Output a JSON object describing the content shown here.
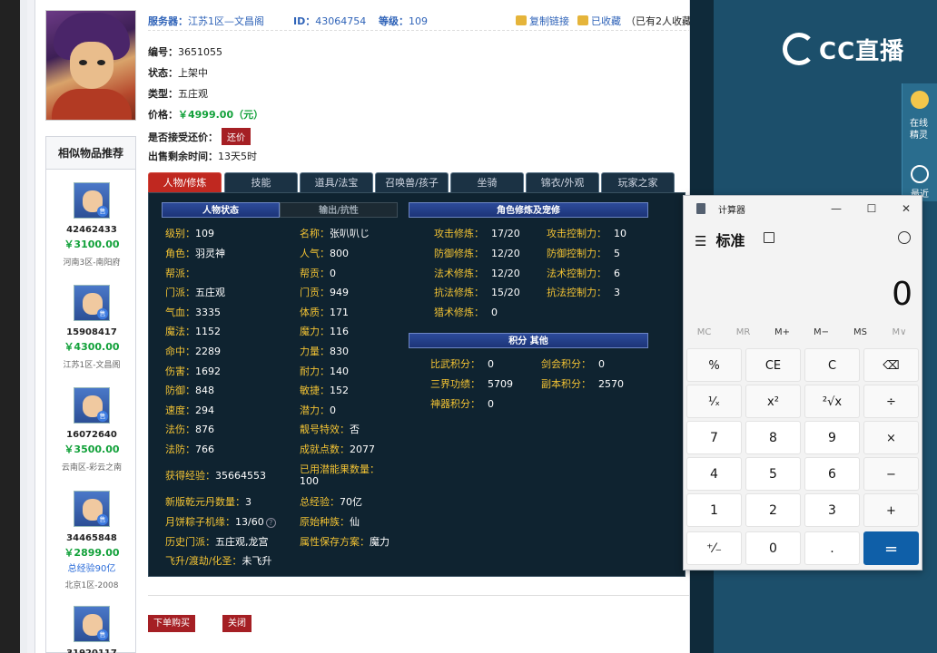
{
  "top": {
    "server_label": "服务器：",
    "server_value": "江苏1区—文昌阁",
    "id_label": "ID：",
    "id_value": "43064754",
    "level_label": "等级：",
    "level_value": "109",
    "copy_link": "复制链接",
    "favorited": "已收藏",
    "fav_count": "（已有2人收藏）"
  },
  "info": {
    "number_label": "编号：",
    "number_value": "3651055",
    "status_label": "状态：",
    "status_value": "上架中",
    "type_label": "类型：",
    "type_value": "五庄观",
    "price_label": "价格：",
    "price_value": "￥4999.00（元）",
    "bargain_label": "是否接受还价：",
    "bargain_btn": "还价",
    "remain_label": "出售剩余时间：",
    "remain_value": "13天5时"
  },
  "similar": {
    "title": "相似物品推荐",
    "items": [
      {
        "id": "42462433",
        "price": "￥3100.00",
        "extra": "",
        "server": "河南3区-南阳府"
      },
      {
        "id": "15908417",
        "price": "￥4300.00",
        "extra": "",
        "server": "江苏1区-文昌阁"
      },
      {
        "id": "16072640",
        "price": "￥3500.00",
        "extra": "",
        "server": "云南区-彩云之南"
      },
      {
        "id": "34465848",
        "price": "￥2899.00",
        "extra": "总经验90亿",
        "server": "北京1区-2008"
      },
      {
        "id": "31920117",
        "price": "",
        "extra": "",
        "server": ""
      }
    ]
  },
  "tabs": [
    "人物/修炼",
    "技能",
    "道具/法宝",
    "召唤兽/孩子",
    "坐骑",
    "锦衣/外观",
    "玩家之家"
  ],
  "panel": {
    "head_status": "人物状态",
    "head_output": "输出/抗性",
    "head_cultivation": "角色修炼及宠修",
    "head_points": "积分 其他",
    "left": [
      {
        "k": "级别：",
        "v": "109"
      },
      {
        "k": "角色：",
        "v": "羽灵神"
      },
      {
        "k": "帮派：",
        "v": ""
      },
      {
        "k": "门派：",
        "v": "五庄观"
      },
      {
        "k": "气血：",
        "v": "3335"
      },
      {
        "k": "魔法：",
        "v": "1152"
      },
      {
        "k": "命中：",
        "v": "2289"
      },
      {
        "k": "伤害：",
        "v": "1692"
      },
      {
        "k": "防御：",
        "v": "848"
      },
      {
        "k": "速度：",
        "v": "294"
      },
      {
        "k": "法伤：",
        "v": "876"
      },
      {
        "k": "法防：",
        "v": "766"
      }
    ],
    "mid": [
      {
        "k": "名称：",
        "v": "张叭叭じ"
      },
      {
        "k": "人气：",
        "v": "800"
      },
      {
        "k": "帮贡：",
        "v": "0"
      },
      {
        "k": "门贡：",
        "v": "949"
      },
      {
        "k": "体质：",
        "v": "171"
      },
      {
        "k": "魔力：",
        "v": "116"
      },
      {
        "k": "力量：",
        "v": "830"
      },
      {
        "k": "耐力：",
        "v": "140"
      },
      {
        "k": "敏捷：",
        "v": "152"
      },
      {
        "k": "潜力：",
        "v": "0"
      },
      {
        "k": "靓号特效：",
        "v": "否"
      },
      {
        "k": "成就点数：",
        "v": "2077"
      }
    ],
    "exp_label": "获得经验：",
    "exp_value": "35664553",
    "potential_label": "已用潜能果数量：",
    "potential_value": "100",
    "qiankun_label": "新版乾元丹数量：",
    "qiankun_value": "3",
    "total_exp_label": "总经验：",
    "total_exp_value": "70亿",
    "moon_label": "月饼粽子机缘：",
    "moon_value": "13/60",
    "race_label": "原始种族：",
    "race_value": "仙",
    "history_label": "历史门派：",
    "history_value": "五庄观,龙宫",
    "attr_label": "属性保存方案：",
    "attr_value": "魔力",
    "fly_label": "飞升/渡劫/化圣：",
    "fly_value": "未飞升",
    "cult": [
      {
        "k": "攻击修炼：",
        "v": "17/20",
        "k2": "攻击控制力：",
        "v2": "10"
      },
      {
        "k": "防御修炼：",
        "v": "12/20",
        "k2": "防御控制力：",
        "v2": "5"
      },
      {
        "k": "法术修炼：",
        "v": "12/20",
        "k2": "法术控制力：",
        "v2": "6"
      },
      {
        "k": "抗法修炼：",
        "v": "15/20",
        "k2": "抗法控制力：",
        "v2": "3"
      },
      {
        "k": "猎术修炼：",
        "v": "0",
        "k2": "",
        "v2": ""
      }
    ],
    "points": [
      {
        "k": "比武积分：",
        "v": "0",
        "k2": "剑会积分：",
        "v2": "0"
      },
      {
        "k": "三界功绩：",
        "v": "5709",
        "k2": "副本积分：",
        "v2": "2570"
      },
      {
        "k": "神器积分：",
        "v": "0",
        "k2": "",
        "v2": ""
      }
    ]
  },
  "buttons": {
    "buy": "下单购买",
    "close": "关闭"
  },
  "cc": {
    "logo": "CC直播",
    "tool1": "在线精灵",
    "tool2": "最近"
  },
  "calc": {
    "title": "计算器",
    "mode": "标准",
    "display": "0",
    "mem": [
      "MC",
      "MR",
      "M+",
      "M−",
      "MS",
      "M∨"
    ],
    "keys": [
      [
        "%",
        "CE",
        "C",
        "⌫"
      ],
      [
        "¹⁄ₓ",
        "x²",
        "²√x",
        "÷"
      ],
      [
        "7",
        "8",
        "9",
        "×"
      ],
      [
        "4",
        "5",
        "6",
        "−"
      ],
      [
        "1",
        "2",
        "3",
        "+"
      ],
      [
        "⁺⁄₋",
        "0",
        ".",
        "="
      ]
    ]
  }
}
